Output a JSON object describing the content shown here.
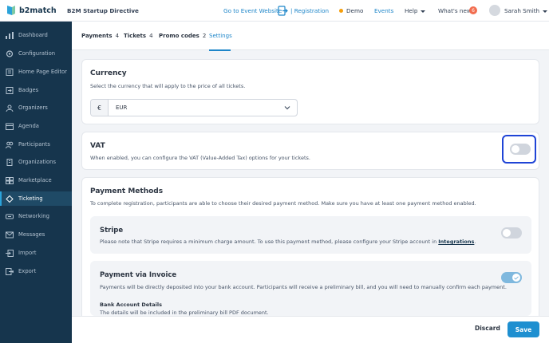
{
  "header": {
    "logo_text": "b2match",
    "event_name": "B2M Startup Directive",
    "go_to_website": "Go to Event Website",
    "registration": "| Registration",
    "demo": "Demo",
    "events": "Events",
    "help": "Help",
    "whats_new": "What's new",
    "whats_new_count": "6",
    "user_name": "Sarah Smith"
  },
  "sidebar": {
    "items": [
      {
        "label": "Dashboard",
        "icon": "dashboard-icon"
      },
      {
        "label": "Configuration",
        "icon": "configuration-icon"
      },
      {
        "label": "Home Page Editor",
        "icon": "page-editor-icon"
      },
      {
        "label": "Badges",
        "icon": "badge-icon"
      },
      {
        "label": "Organizers",
        "icon": "organizers-icon"
      },
      {
        "label": "Agenda",
        "icon": "agenda-icon"
      },
      {
        "label": "Participants",
        "icon": "participants-icon"
      },
      {
        "label": "Organizations",
        "icon": "organizations-icon"
      },
      {
        "label": "Marketplace",
        "icon": "marketplace-icon"
      },
      {
        "label": "Ticketing",
        "icon": "ticketing-icon",
        "active": true
      },
      {
        "label": "Networking",
        "icon": "networking-icon"
      },
      {
        "label": "Messages",
        "icon": "messages-icon"
      },
      {
        "label": "Import",
        "icon": "import-icon"
      },
      {
        "label": "Export",
        "icon": "export-icon"
      }
    ]
  },
  "tabs": [
    {
      "label": "Payments",
      "count": "4"
    },
    {
      "label": "Tickets",
      "count": "4"
    },
    {
      "label": "Promo codes",
      "count": "2"
    },
    {
      "label": "Settings",
      "count": "",
      "active": true
    }
  ],
  "currency": {
    "title": "Currency",
    "description": "Select the currency that will apply to the price of all tickets.",
    "symbol": "€",
    "value": "EUR"
  },
  "vat": {
    "title": "VAT",
    "description": "When enabled, you can configure the VAT (Value-Added Tax) options for your tickets.",
    "enabled": false
  },
  "payment_methods": {
    "title": "Payment Methods",
    "description": "To complete registration, participants are able to choose their desired payment method. Make sure you have at least one payment method enabled.",
    "stripe": {
      "title": "Stripe",
      "description": "Please note that Stripe requires a minimum charge amount. To use this payment method, please configure your Stripe account in",
      "link": "Integrations",
      "enabled": false
    },
    "invoice": {
      "title": "Payment via Invoice",
      "description": "Payments will be directly deposited into your bank account. Participants will receive a preliminary bill, and you will need to manually confirm each payment.",
      "enabled": true,
      "bank_title": "Bank Account Details",
      "bank_description": "The details will be included in the preliminary bill PDF document."
    }
  },
  "footer": {
    "discard": "Discard",
    "save": "Save"
  },
  "colors": {
    "sidebar_bg": "#16354d",
    "accent": "#1e86c9",
    "save_button": "#1e8fd0",
    "highlight": "#1f44d6"
  }
}
